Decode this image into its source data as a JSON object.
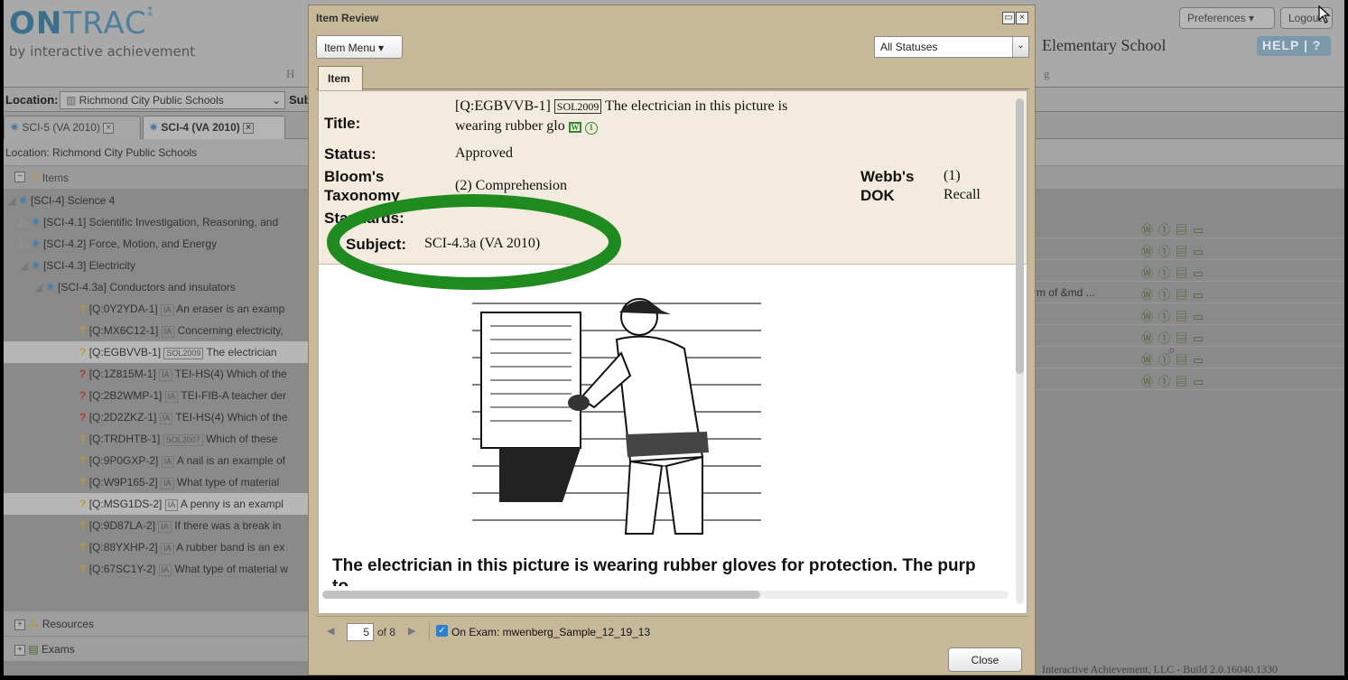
{
  "app": {
    "logo_main": "ON",
    "logo_light": "TRAC",
    "logo_sub": "by interactive achievement",
    "school": "Elementary School",
    "preferences": "Preferences",
    "logout": "Logout",
    "help": "HELP | ?",
    "hdr_h": "H",
    "hdr_g": "g"
  },
  "location_bar": {
    "label": "Location:",
    "value": "Richmond City Public Schools",
    "subject_label": "Subj"
  },
  "tabs": [
    {
      "label": "SCI-5 (VA 2010)"
    },
    {
      "label": "SCI-4 (VA 2010)"
    }
  ],
  "location_line": "Location: Richmond City Public Schools",
  "tree": {
    "header": "Items",
    "rows": [
      {
        "text": "[SCI-4] Science 4"
      },
      {
        "text": "[SCI-4.1] Scientific Investigation, Reasoning, and"
      },
      {
        "text": "[SCI-4.2] Force, Motion, and Energy"
      },
      {
        "text": "[SCI-4.3] Electricity"
      },
      {
        "text": "[SCI-4.3a] Conductors and insulators"
      },
      {
        "id": "[Q:0Y2YDA-1]",
        "tag": "IA",
        "text": "An eraser is an examp"
      },
      {
        "id": "[Q:MX6C12-1]",
        "tag": "IA",
        "text": "Concerning electricity,"
      },
      {
        "id": "[Q:EGBVVB-1]",
        "tag": "SOL2009",
        "text": "The electrician"
      },
      {
        "id": "[Q:1Z815M-1]",
        "tag": "IA",
        "text": "TEI-HS(4) Which of the"
      },
      {
        "id": "[Q:2B2WMP-1]",
        "tag": "IA",
        "text": "TEI-FIB-A teacher der"
      },
      {
        "id": "[Q:2D2ZKZ-1]",
        "tag": "IA",
        "text": "TEI-HS(4) Which of the"
      },
      {
        "id": "[Q:TRDHTB-1]",
        "tag": "SOL2007",
        "text": "Which of these"
      },
      {
        "id": "[Q:9P0GXP-2]",
        "tag": "IA",
        "text": "A nail is an example of"
      },
      {
        "id": "[Q:W9P165-2]",
        "tag": "IA",
        "text": "What type of material"
      },
      {
        "id": "[Q:MSG1DS-2]",
        "tag": "IA",
        "text": "A penny is an exampl"
      },
      {
        "id": "[Q:9D87LA-2]",
        "tag": "IA",
        "text": "If there was a break in"
      },
      {
        "id": "[Q:88YXHP-2]",
        "tag": "IA",
        "text": "A rubber band is an ex"
      },
      {
        "id": "[Q:67SC1Y-2]",
        "tag": "IA",
        "text": "What type of material w"
      }
    ],
    "resources": "Resources",
    "exams": "Exams"
  },
  "right_grid": {
    "row_text": "rm of &md ..."
  },
  "footer": "Interactive Achievement, LLC - Build 2.0.16040.1330",
  "modal": {
    "title": "Item Review",
    "item_menu": "Item Menu",
    "status_filter": "All Statuses",
    "tab": "Item",
    "labels": {
      "title": "Title:",
      "status": "Status:",
      "bloom1": "Bloom's",
      "bloom2": "Taxonomy",
      "standards": "Standards:",
      "subject": "Subject:",
      "webb1": "Webb's",
      "webb2": "DOK"
    },
    "values": {
      "title_id": "[Q:EGBVVB-1]",
      "title_sol": "SOL2009",
      "title_text1": "The electrician in this picture is",
      "title_text2": "wearing rubber glo",
      "status": "Approved",
      "bloom": "(2) Comprehension",
      "webb_num": "(1)",
      "webb_text": "Recall",
      "subject": "SCI-4.3a (VA 2010)"
    },
    "question_text": "The electrician in this picture is wearing rubber gloves for protection. The purp",
    "question_text2": "to",
    "pager": {
      "current": "5",
      "of_label": "of 8"
    },
    "on_exam": "On Exam: mwenberg_Sample_12_19_13",
    "close": "Close"
  },
  "annotation": {
    "ellipse_color": "#1f8a1f"
  }
}
